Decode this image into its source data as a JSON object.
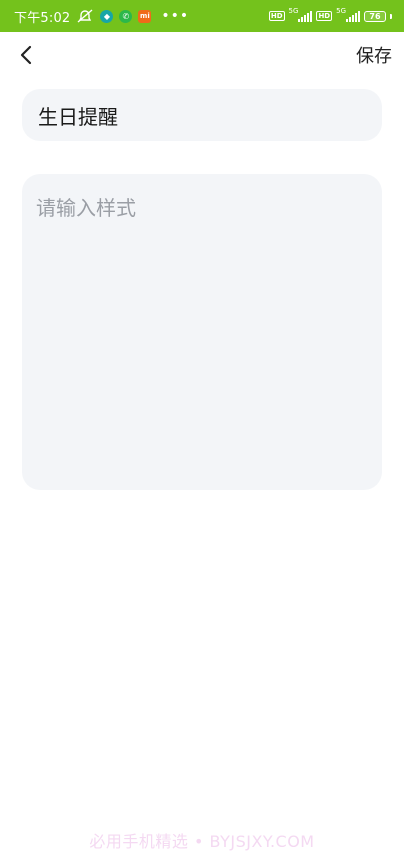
{
  "status_bar": {
    "time": "下午5:02",
    "network_1": "5G",
    "network_2": "5G",
    "hd_1": "HD",
    "hd_2": "HD",
    "battery": "76",
    "app_icon_3": "mi",
    "colors": {
      "background": "#74c21c"
    }
  },
  "nav": {
    "save_label": "保存"
  },
  "form": {
    "title_value": "生日提醒",
    "style_placeholder": "请输入样式",
    "style_value": ""
  },
  "watermark": "必用手机精选 • BYJSJXY.COM"
}
